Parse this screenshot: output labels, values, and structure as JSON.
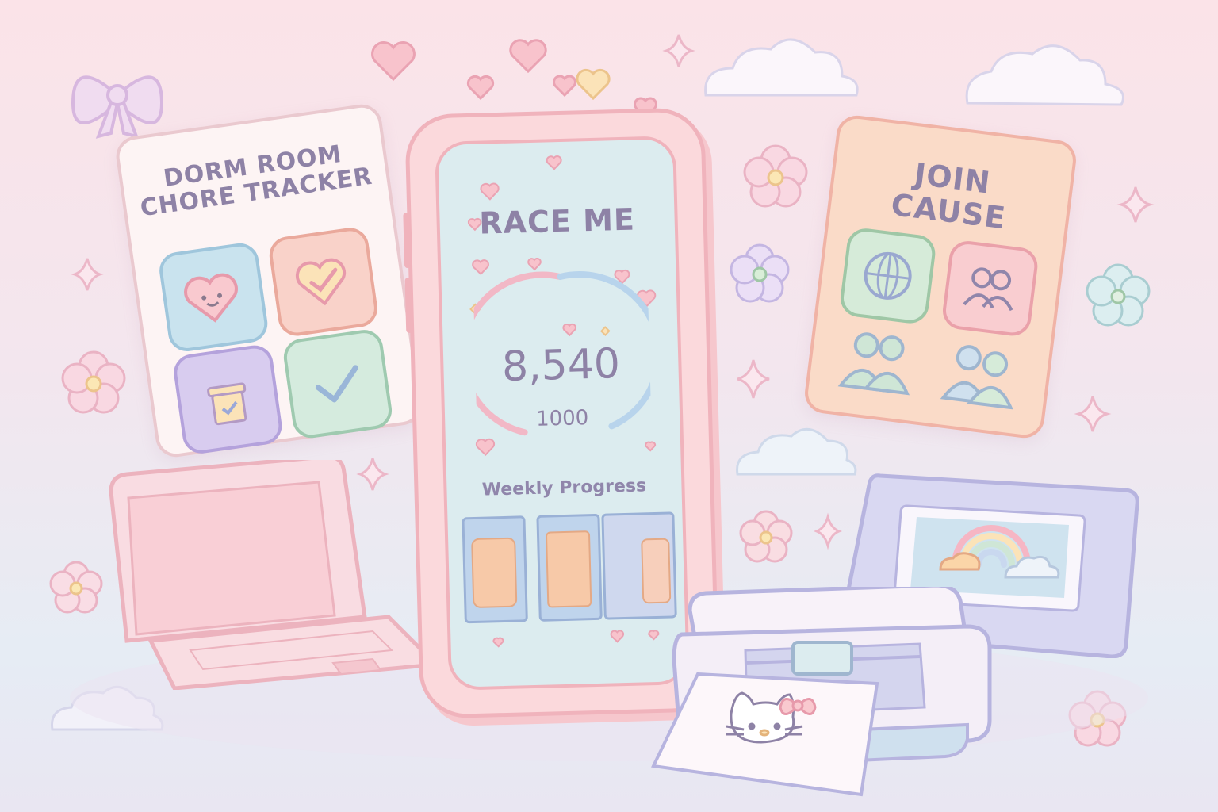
{
  "chore_card": {
    "title_line1": "DORM ROOM",
    "title_line2": "CHORE TRACKER",
    "tiles": [
      {
        "icon": "smiling-heart-icon",
        "color": "#bfe0ec"
      },
      {
        "icon": "heart-icon",
        "color": "#f8c9c0"
      },
      {
        "icon": "box-check-icon",
        "color": "#cdbfe6"
      },
      {
        "icon": "checkmark-icon",
        "color": "#cfe6d6"
      }
    ]
  },
  "phone": {
    "title": "RACE ME",
    "value": "8,540",
    "goal": "1000",
    "progress_label": "Weekly Progress",
    "colors": {
      "arc_left": "#f2b8c6",
      "arc_right": "#b8d4ec",
      "screen": "#dcecef"
    }
  },
  "cause_card": {
    "title_line1": "JOIN",
    "title_line2": "CAUSE",
    "tiles": [
      {
        "icon": "globe-icon"
      },
      {
        "icon": "people-icon"
      },
      {
        "icon": "group-icon"
      },
      {
        "icon": "community-icon"
      }
    ]
  }
}
